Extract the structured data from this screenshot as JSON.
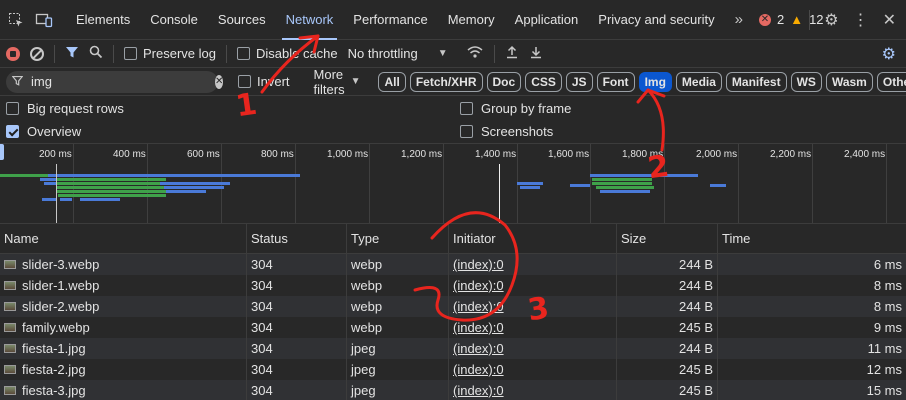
{
  "colors": {
    "accent": "#a8c7fa",
    "active_chip": "#0b57d0",
    "annotation": "#e8251e",
    "error": "#e46962",
    "warning": "#f9ab00"
  },
  "topbar": {
    "tabs": [
      {
        "label": "Elements"
      },
      {
        "label": "Console"
      },
      {
        "label": "Sources"
      },
      {
        "label": "Network"
      },
      {
        "label": "Performance"
      },
      {
        "label": "Memory"
      },
      {
        "label": "Application"
      },
      {
        "label": "Privacy and security"
      }
    ],
    "active_tab": "Network",
    "more": "»",
    "error_count": "2",
    "warning_count": "12"
  },
  "toolbar": {
    "preserve_log": "Preserve log",
    "disable_cache": "Disable cache",
    "throttling": "No throttling"
  },
  "filterbar": {
    "filter_value": "img",
    "invert": "Invert",
    "more_filters": "More filters",
    "chips": [
      "All",
      "Fetch/XHR",
      "Doc",
      "CSS",
      "JS",
      "Font",
      "Img",
      "Media",
      "Manifest",
      "WS",
      "Wasm",
      "Other"
    ],
    "active_chip": "Img"
  },
  "options": {
    "big_request_rows": "Big request rows",
    "overview": "Overview",
    "group_by_frame": "Group by frame",
    "screenshots": "Screenshots"
  },
  "overview": {
    "ticks": [
      "200 ms",
      "400 ms",
      "600 ms",
      "800 ms",
      "1,000 ms",
      "1,200 ms",
      "1,400 ms",
      "1,600 ms",
      "1,800 ms",
      "2,000 ms",
      "2,200 ms",
      "2,400 ms"
    ]
  },
  "table": {
    "headers": [
      "Name",
      "Status",
      "Type",
      "Initiator",
      "Size",
      "Time"
    ],
    "rows": [
      {
        "name": "slider-3.webp",
        "status": "304",
        "type": "webp",
        "initiator": "(index):0",
        "size": "244 B",
        "time": "6 ms"
      },
      {
        "name": "slider-1.webp",
        "status": "304",
        "type": "webp",
        "initiator": "(index):0",
        "size": "244 B",
        "time": "8 ms"
      },
      {
        "name": "slider-2.webp",
        "status": "304",
        "type": "webp",
        "initiator": "(index):0",
        "size": "244 B",
        "time": "8 ms"
      },
      {
        "name": "family.webp",
        "status": "304",
        "type": "webp",
        "initiator": "(index):0",
        "size": "245 B",
        "time": "9 ms"
      },
      {
        "name": "fiesta-1.jpg",
        "status": "304",
        "type": "jpeg",
        "initiator": "(index):0",
        "size": "244 B",
        "time": "11 ms"
      },
      {
        "name": "fiesta-2.jpg",
        "status": "304",
        "type": "jpeg",
        "initiator": "(index):0",
        "size": "245 B",
        "time": "12 ms"
      },
      {
        "name": "fiesta-3.jpg",
        "status": "304",
        "type": "jpeg",
        "initiator": "(index):0",
        "size": "245 B",
        "time": "15 ms"
      }
    ]
  },
  "annotations": [
    "1",
    "2",
    "3"
  ]
}
